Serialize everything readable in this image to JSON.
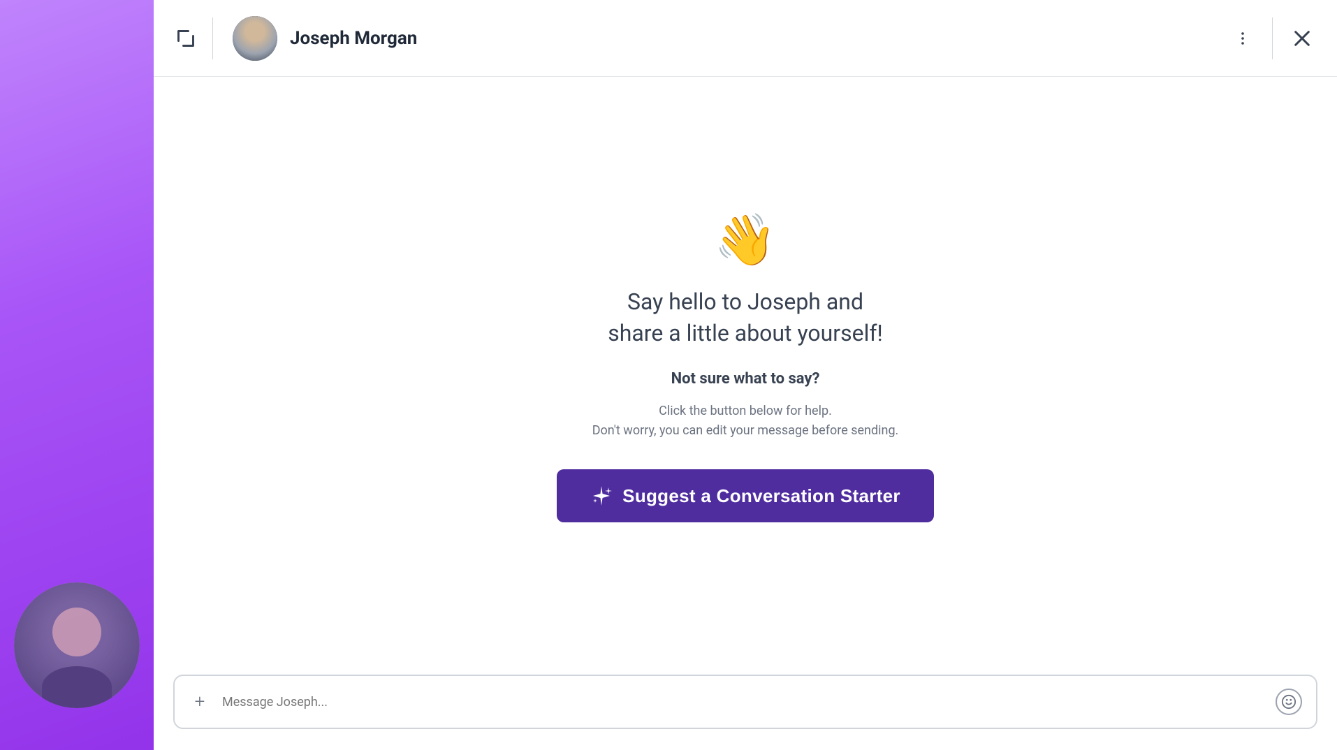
{
  "leftPanel": {
    "backgroundColor": "#a855f7"
  },
  "header": {
    "title": "Joseph Morgan",
    "expandIcon": "expand-icon",
    "moreIcon": "more-options-icon",
    "closeIcon": "close-icon"
  },
  "chatBody": {
    "waveEmoji": "👋",
    "helloText": "Say hello to Joseph and\nshare a little about yourself!",
    "notSureText": "Not sure what to say?",
    "helpLine1": "Click the button below for help.",
    "helpLine2": "Don't worry, you can edit your message before sending.",
    "suggestButton": {
      "label": "Suggest a Conversation Starter",
      "icon": "sparkles-icon",
      "backgroundColor": "#4f2d9e"
    }
  },
  "footer": {
    "inputPlaceholder": "Message Joseph...",
    "addIcon": "plus-icon",
    "emojiIcon": "emoji-icon"
  }
}
